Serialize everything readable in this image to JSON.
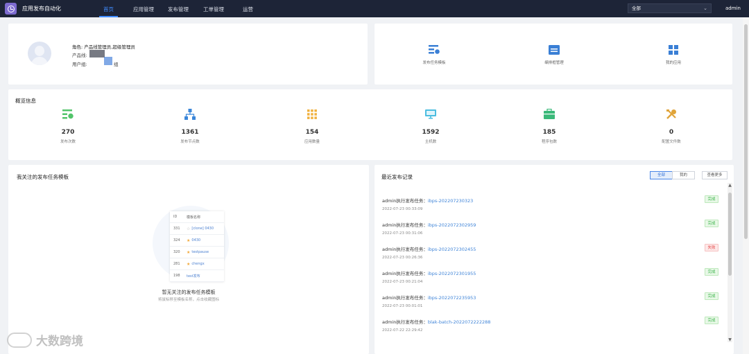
{
  "topbar": {
    "app_title": "应用发布自动化",
    "nav": [
      "首页",
      "应用管理",
      "发布管理",
      "工单管理",
      "运营"
    ],
    "active_nav": "首页",
    "scope_select": "全部",
    "user": "admin"
  },
  "profile": {
    "role": "角色: 产品线管理员,超级管理员",
    "product_line": "产品线:",
    "user_group_prefix": "用户组:",
    "user_group_suffix": "组"
  },
  "quick_links": [
    {
      "label": "发布任务模板",
      "icon": "task-template-icon"
    },
    {
      "label": "编排框管理",
      "icon": "folder-icon"
    },
    {
      "label": "我的应用",
      "icon": "apps-grid-icon"
    }
  ],
  "overview": {
    "title": "概览信息",
    "stats": [
      {
        "value": "270",
        "label": "发布次数",
        "icon": "release-count-icon",
        "color": "#52c46a"
      },
      {
        "value": "1361",
        "label": "发布节点数",
        "icon": "node-tree-icon",
        "color": "#3a86d9"
      },
      {
        "value": "154",
        "label": "应用数量",
        "icon": "apps-dots-icon",
        "color": "#f1b13e"
      },
      {
        "value": "1592",
        "label": "主机数",
        "icon": "monitor-icon",
        "color": "#4bbde0"
      },
      {
        "value": "185",
        "label": "程序包数",
        "icon": "package-icon",
        "color": "#3bb97a"
      },
      {
        "value": "0",
        "label": "配置文件数",
        "icon": "tools-icon",
        "color": "#e0a43a"
      }
    ]
  },
  "followed": {
    "title": "我关注的发布任务模板",
    "illustration": {
      "header": [
        "ID",
        "模板名称"
      ],
      "rows": [
        {
          "id": "331",
          "name": "[clone] 0430",
          "starred": false
        },
        {
          "id": "324",
          "name": "0430",
          "starred": true
        },
        {
          "id": "320",
          "name": "testpause",
          "starred": true
        },
        {
          "id": "281",
          "name": "chengx",
          "starred": true
        },
        {
          "id": "198",
          "name": "test发布",
          "starred": false
        }
      ]
    },
    "empty_title": "暂无关注的发布任务模板",
    "empty_sub": "将鼠标移至模板名称，点击收藏图标"
  },
  "recent": {
    "title": "最近发布记录",
    "filters": [
      "全部",
      "我的"
    ],
    "active_filter": "全部",
    "more": "查看更多",
    "records": [
      {
        "prefix": "admin执行发布任务：",
        "task": "ibps-202207230323",
        "time": "2022-07-23 00:33:09",
        "status": "完成",
        "ok": true
      },
      {
        "prefix": "admin执行发布任务：",
        "task": "ibps-2022072302959",
        "time": "2022-07-23 00:31:06",
        "status": "完成",
        "ok": true
      },
      {
        "prefix": "admin执行发布任务：",
        "task": "ibps-2022072302455",
        "time": "2022-07-23 00:26:36",
        "status": "失败",
        "ok": false
      },
      {
        "prefix": "admin执行发布任务：",
        "task": "ibps-2022072301955",
        "time": "2022-07-23 00:21:04",
        "status": "完成",
        "ok": true
      },
      {
        "prefix": "admin执行发布任务：",
        "task": "ibps-2022072235953",
        "time": "2022-07-23 00:01:01",
        "status": "完成",
        "ok": true
      },
      {
        "prefix": "admin执行发布任务：",
        "task": "blak-batch-2022072222288",
        "time": "2022-07-22 22:29:42",
        "status": "完成",
        "ok": true
      }
    ]
  },
  "watermark": "大数跨境"
}
